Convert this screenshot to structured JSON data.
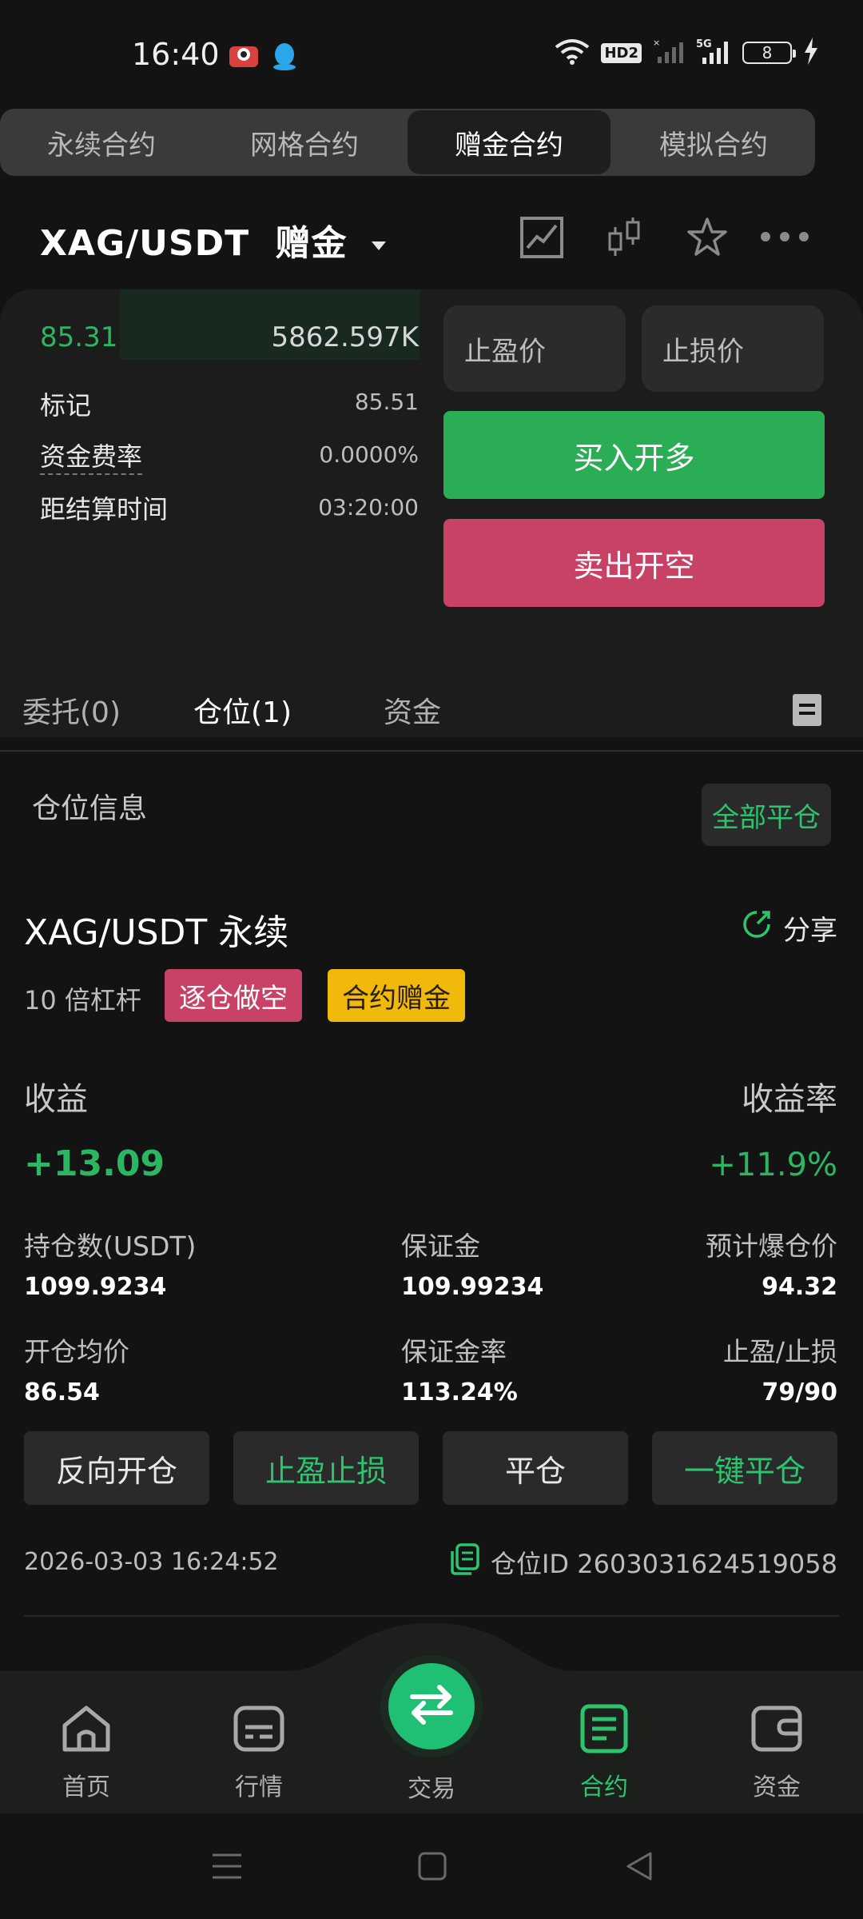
{
  "status_bar": {
    "time": "16:40",
    "hd": "HD2",
    "network": "5G",
    "battery": "8"
  },
  "top_tabs": [
    {
      "label": "永续合约",
      "active": false
    },
    {
      "label": "网格合约",
      "active": false
    },
    {
      "label": "赠金合约",
      "active": true
    },
    {
      "label": "模拟合约",
      "active": false
    }
  ],
  "header": {
    "pair": "XAG/USDT",
    "mode": "赠金"
  },
  "order_book": {
    "price": "85.31",
    "volume": "5862.597K"
  },
  "market_info": {
    "mark_label": "标记",
    "mark_value": "85.51",
    "funding_label": "资金费率",
    "funding_value": "0.0000%",
    "settle_label": "距结算时间",
    "settle_value": "03:20:00"
  },
  "order_form": {
    "tp_placeholder": "止盈价",
    "sl_placeholder": "止损价",
    "buy_label": "买入开多",
    "sell_label": "卖出开空"
  },
  "order_tabs": [
    {
      "label": "委托(0)",
      "active": false
    },
    {
      "label": "仓位(1)",
      "active": true
    },
    {
      "label": "资金",
      "active": false
    }
  ],
  "position": {
    "section_title": "仓位信息",
    "close_all": "全部平仓",
    "symbol": "XAG/USDT 永续",
    "share": "分享",
    "leverage": "10 倍杠杆",
    "tag_side": "逐仓做空",
    "tag_bonus": "合约赠金",
    "pnl_label": "收益",
    "pnl_rate_label": "收益率",
    "pnl": "+13.09",
    "pnl_rate": "+11.9%",
    "size_label": "持仓数(USDT)",
    "size": "1099.9234",
    "margin_label": "保证金",
    "margin": "109.99234",
    "liq_label": "预计爆仓价",
    "liq": "94.32",
    "entry_label": "开仓均价",
    "entry": "86.54",
    "margin_rate_label": "保证金率",
    "margin_rate": "113.24%",
    "tpsl_label": "止盈/止损",
    "tpsl": "79/90",
    "btn_reverse": "反向开仓",
    "btn_tpsl": "止盈止损",
    "btn_close": "平仓",
    "btn_close_all": "一键平仓",
    "timestamp": "2026-03-03 16:24:52",
    "position_id": "仓位ID 2603031624519058"
  },
  "bottom_nav": [
    {
      "label": "首页",
      "icon": "home-icon"
    },
    {
      "label": "行情",
      "icon": "market-icon"
    },
    {
      "label": "交易",
      "icon": "swap-icon"
    },
    {
      "label": "合约",
      "icon": "contract-icon",
      "active": true
    },
    {
      "label": "资金",
      "icon": "wallet-icon"
    }
  ],
  "colors": {
    "green": "#2cb562",
    "red": "#c84266",
    "yellow": "#f0b90b",
    "accent": "#1fbf74"
  }
}
